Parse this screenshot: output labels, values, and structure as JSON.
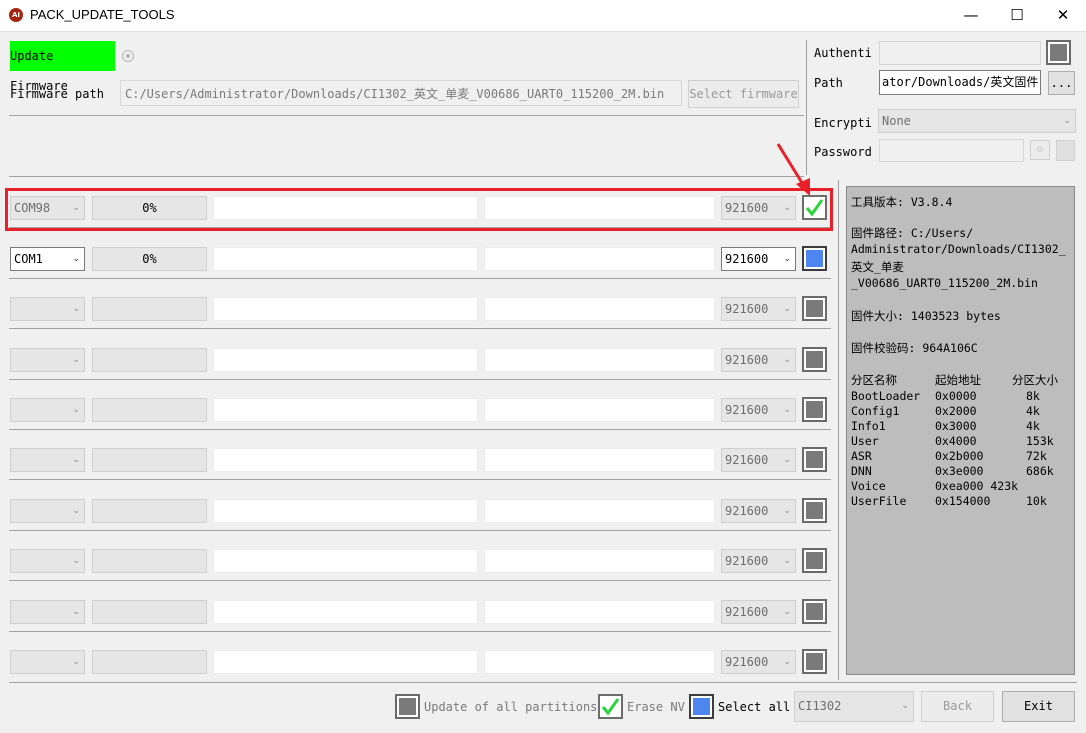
{
  "window": {
    "title": "PACK_UPDATE_TOOLS",
    "app_icon": "AI",
    "min": "—",
    "max": "☐",
    "close": "✕"
  },
  "firmware": {
    "mode_label": "Update Firmware",
    "path_label": "Firmware path",
    "path_value": "C:/Users/Administrator/Downloads/CI1302_英文_单麦_V00686_UART0_115200_2M.bin",
    "select_button": "Select firmware"
  },
  "auth": {
    "authentic_label": "Authentic",
    "path_label": "Path",
    "path_value": "ator/Downloads/英文固件",
    "browse_button": "...",
    "encryption_label": "Encryptio",
    "encryption_value": "None",
    "password_label": "Password:"
  },
  "ports": [
    {
      "com": "COM98",
      "progress": "0%",
      "baud": "921600",
      "state": "checked-green",
      "enabled": false
    },
    {
      "com": "COM1",
      "progress": "0%",
      "baud": "921600",
      "state": "blue",
      "enabled": true
    },
    {
      "com": "",
      "progress": "",
      "baud": "921600",
      "state": "gray",
      "enabled": false
    },
    {
      "com": "",
      "progress": "",
      "baud": "921600",
      "state": "gray",
      "enabled": false
    },
    {
      "com": "",
      "progress": "",
      "baud": "921600",
      "state": "gray",
      "enabled": false
    },
    {
      "com": "",
      "progress": "",
      "baud": "921600",
      "state": "gray",
      "enabled": false
    },
    {
      "com": "",
      "progress": "",
      "baud": "921600",
      "state": "gray",
      "enabled": false
    },
    {
      "com": "",
      "progress": "",
      "baud": "921600",
      "state": "gray",
      "enabled": false
    },
    {
      "com": "",
      "progress": "",
      "baud": "921600",
      "state": "gray",
      "enabled": false
    },
    {
      "com": "",
      "progress": "",
      "baud": "921600",
      "state": "gray",
      "enabled": false
    }
  ],
  "info": {
    "tool_version": "工具版本: V3.8.4",
    "fw_path_l1": "固件路径: C:/Users/",
    "fw_path_l2": "Administrator/Downloads/CI1302_",
    "fw_path_l3": "英文_单麦",
    "fw_path_l4": "_V00686_UART0_115200_2M.bin",
    "fw_size": "固件大小: 1403523 bytes",
    "fw_checksum": "固件校验码: 964A106C",
    "table_header": [
      "分区名称",
      "起始地址",
      "分区大小"
    ],
    "partitions": [
      [
        "BootLoader",
        "0x0000",
        "8k"
      ],
      [
        "Config1",
        "0x2000",
        "4k"
      ],
      [
        "Info1",
        "0x3000",
        "4k"
      ],
      [
        "User",
        "0x4000",
        "153k"
      ],
      [
        "ASR",
        "0x2b000",
        "72k"
      ],
      [
        "DNN",
        "0x3e000",
        "686k"
      ],
      [
        "Voice",
        "0xea000 423k",
        ""
      ],
      [
        "UserFile",
        "0x154000",
        "10k"
      ]
    ]
  },
  "footer": {
    "update_all_label": "Update of all partitions",
    "erase_nv_label": "Erase NV",
    "select_all_label": "Select all",
    "chip_value": "CI1302",
    "back_button": "Back",
    "exit_button": "Exit"
  },
  "colors": {
    "highlight_red": "#e8202a",
    "green_label": "#00ff00",
    "check_green": "#2bd43a",
    "blue_box": "#4d86f0"
  }
}
